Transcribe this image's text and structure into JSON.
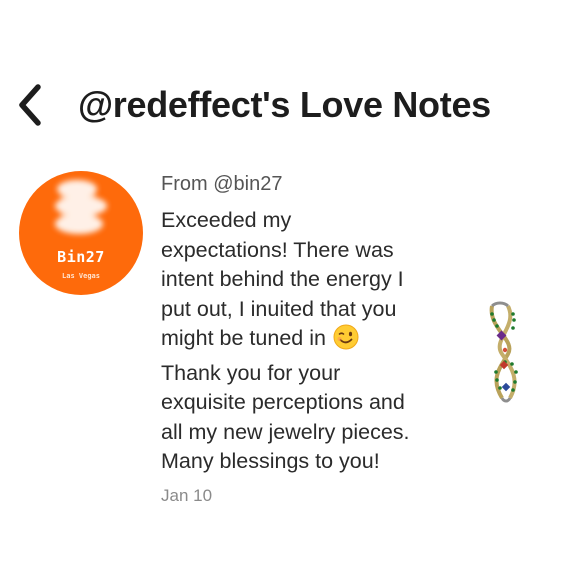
{
  "header": {
    "back_icon": "chevron-left-icon",
    "title": "@redeffect's Love Notes"
  },
  "note": {
    "avatar": {
      "name": "Bin27",
      "subtitle": "Las Vegas",
      "background": "#fe6a0b"
    },
    "from": "From @bin27",
    "body_before_emoji": "Exceeded my expectations! There was intent behind the energy I put out, I inuited that you might be tuned in",
    "emoji": "winking-face-emoji",
    "body_after_emoji": "Thank you for your exquisite perceptions and all my new jewelry pieces. Many blessings to you!",
    "date": "Jan 10",
    "product_image": "jeweled-bracelet-thumbnail"
  }
}
